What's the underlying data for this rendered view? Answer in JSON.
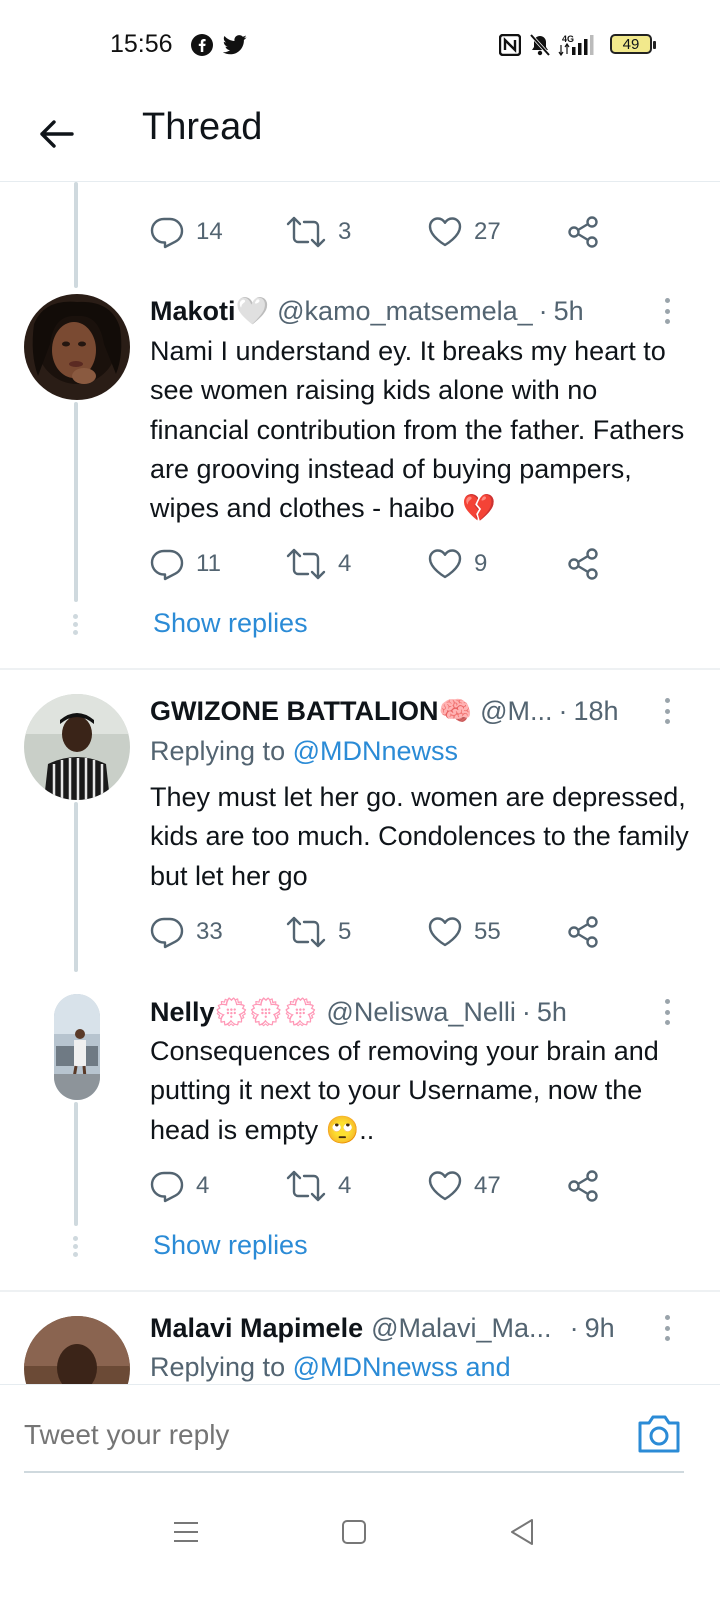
{
  "status_bar": {
    "time": "15:56",
    "battery": "49",
    "network": "4G"
  },
  "header": {
    "title": "Thread"
  },
  "top_actions": {
    "replies": "14",
    "retweets": "3",
    "likes": "27"
  },
  "tweets": [
    {
      "name": "Makoti",
      "name_emoji": "🤍",
      "handle": "@kamo_matsemela_",
      "separator": "·",
      "time": "5h",
      "text": "Nami I understand ey. It breaks my heart to see women raising kids alone with no financial contribution from the father. Fathers are grooving instead of buying pampers, wipes and clothes - haibo 💔",
      "replies": "11",
      "retweets": "4",
      "likes": "9",
      "show_replies": "Show replies"
    },
    {
      "name": "GWIZONE BATTALION",
      "name_emoji": "🧠",
      "handle": "@M...",
      "separator": "·",
      "time": "18h",
      "replying_prefix": "Replying to",
      "replying_to": "@MDNnewss",
      "text": "They must let her go. women are depressed, kids are too much. Condolences to the family but let her go",
      "replies": "33",
      "retweets": "5",
      "likes": "55"
    },
    {
      "name": "Nelly",
      "name_emoji": "💮💮💮",
      "handle": "@Neliswa_Nelli",
      "separator": "·",
      "time": "5h",
      "text": "Consequences of removing your brain and putting it next to your Username, now the head is empty 🙄..",
      "replies": "4",
      "retweets": "4",
      "likes": "47",
      "show_replies": "Show replies"
    },
    {
      "name": "Malavi Mapimele",
      "handle": "@Malavi_Ma...",
      "separator": "·",
      "time": "9h",
      "replying_prefix": "Replying to",
      "replying_to": "@MDNnewss and"
    }
  ],
  "reply_bar": {
    "placeholder": "Tweet your reply"
  },
  "icons": {
    "reply": "reply-icon",
    "retweet": "retweet-icon",
    "like": "heart-icon",
    "share": "share-icon",
    "camera": "camera-icon",
    "back": "back-arrow-icon"
  },
  "colors": {
    "link": "#2b8bd6",
    "secondary_text": "#536471",
    "thread_line": "#cfd9de"
  }
}
